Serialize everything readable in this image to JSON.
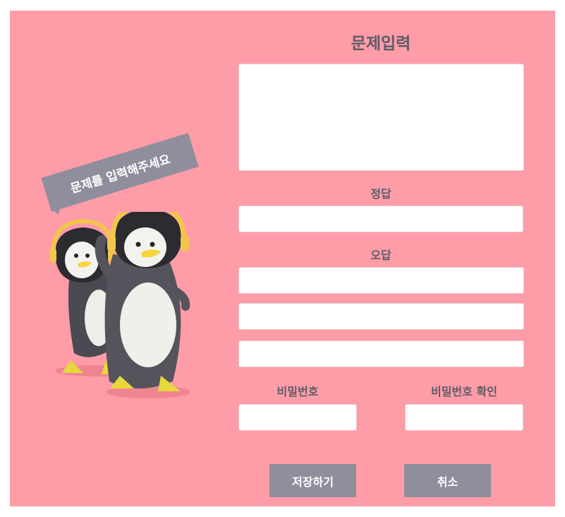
{
  "form": {
    "title": "문제입력",
    "question_value": "",
    "answer_label": "정답",
    "answer_value": "",
    "wrong_label": "오답",
    "wrong_values": [
      "",
      "",
      ""
    ],
    "password_label": "비밀번호",
    "password_confirm_label": "비밀번호 확인",
    "password_value": "",
    "password_confirm_value": ""
  },
  "buttons": {
    "save": "저장하기",
    "cancel": "취소"
  },
  "speech_bubble": {
    "text": "문제를 입력해주세요"
  },
  "colors": {
    "background": "#fe9ca8",
    "button": "#8f8e9c",
    "text": "#5d5c68",
    "field": "#ffffff"
  },
  "illustration": {
    "subject": "two penguin mascots wearing yellow headphones"
  }
}
